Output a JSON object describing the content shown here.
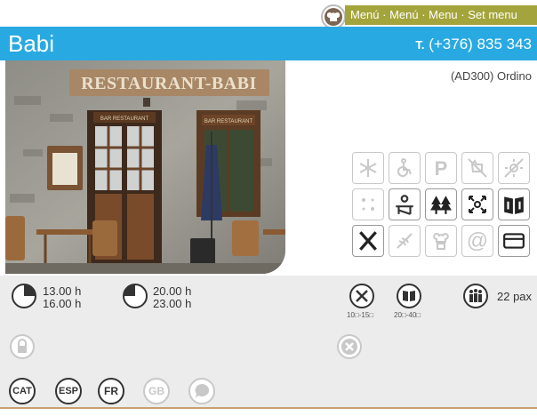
{
  "header": {
    "menu_text": "Menú · Menú · Menu · Set menu",
    "restaurant_name": "Babi",
    "phone_prefix": "T.",
    "phone_number": "(+376) 835 343",
    "address": "(AD300) Ordino"
  },
  "photo": {
    "sign_text": "RESTAURANT-BABI",
    "door_sign_left": "BAR RESTAURANT",
    "door_sign_right": "BAR RESTAURANT"
  },
  "facilities": [
    {
      "name": "snowflake-icon",
      "dim": true
    },
    {
      "name": "wheelchair-icon",
      "dim": true
    },
    {
      "name": "parking-icon",
      "dim": true
    },
    {
      "name": "no-pets-icon",
      "dim": true
    },
    {
      "name": "sun-icon",
      "dim": true
    },
    {
      "name": "sun-small-icon",
      "dim": true
    },
    {
      "name": "terrace-icon",
      "dim": false
    },
    {
      "name": "forest-icon",
      "dim": false
    },
    {
      "name": "expand-icon",
      "dim": false
    },
    {
      "name": "menu-book-icon",
      "dim": false
    },
    {
      "name": "cutlery-icon",
      "dim": false
    },
    {
      "name": "wheat-icon",
      "dim": true
    },
    {
      "name": "chef-icon",
      "dim": true
    },
    {
      "name": "at-icon",
      "dim": true
    },
    {
      "name": "credit-card-icon",
      "dim": false
    }
  ],
  "hours": {
    "lunch_open": "13.00 h",
    "lunch_close": "16.00 h",
    "dinner_open": "20.00 h",
    "dinner_close": "23.00 h"
  },
  "prices": {
    "menu_price": "10□-15□",
    "carta_price": "20□-40□"
  },
  "capacity": {
    "pax": "22 pax"
  },
  "languages": [
    "CAT",
    "ESP",
    "FR",
    "GB"
  ],
  "colors": {
    "title_bar": "#29a9e1",
    "menu_bar": "#a4a43c",
    "info_bg": "#ececec",
    "accent_line": "#c7a16e"
  }
}
